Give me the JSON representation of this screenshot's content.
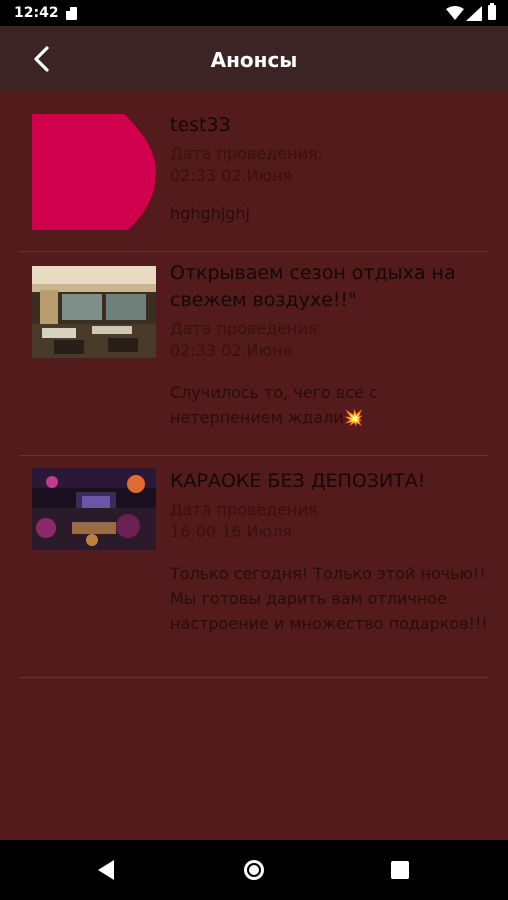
{
  "status_bar": {
    "time": "12:42"
  },
  "app_bar": {
    "title": "Анонсы",
    "back_icon": "chevron-left-icon"
  },
  "events": [
    {
      "title": "test33",
      "date_label": "Дата проведения:",
      "date": " 02:33 02.Июня",
      "description": "hghghjghj",
      "image": "pink-placeholder"
    },
    {
      "title": "Открываем сезон отдыха на свежем воздухе!!\"",
      "date_label": "Дата проведения:",
      "date": " 02:33 02.Июня",
      "description": "Случилось то, чего все с нетерпением ждали💥",
      "image": "terrace-photo"
    },
    {
      "title": "КАРАОКЕ БЕЗ ДЕПОЗИТА!",
      "date_label": "Дата проведения:",
      "date": " 16:00 16.Июля",
      "description": "Только сегодня! Только этой ночью!! Мы готовы дарить вам отличное настроение и множество подарков!!!",
      "image": "karaoke-photo"
    }
  ],
  "nav_bar": {
    "back_icon": "triangle-back-icon",
    "home_icon": "circle-home-icon",
    "recents_icon": "square-recents-icon"
  },
  "colors": {
    "background": "#531b1b",
    "app_bar": "#3d2424",
    "divider": "#6b3434",
    "placeholder_pink": "#d1004d"
  }
}
